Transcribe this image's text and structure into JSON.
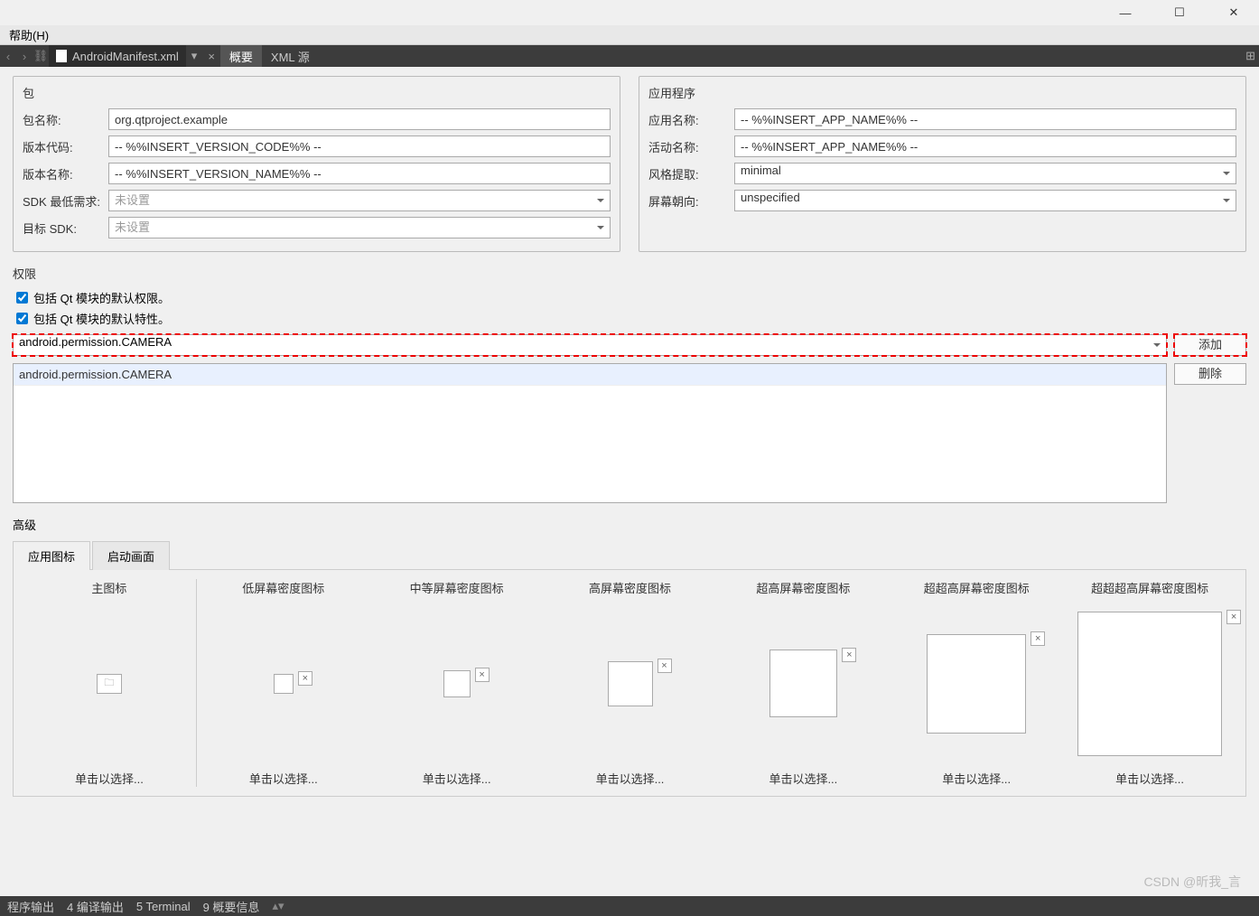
{
  "menu": {
    "help": "帮助(H)"
  },
  "file_tab": {
    "name": "AndroidManifest.xml"
  },
  "sub_tabs": {
    "summary": "概要",
    "xml_source": "XML 源"
  },
  "package_group": {
    "title": "包",
    "name_label": "包名称:",
    "name_value": "org.qtproject.example",
    "version_code_label": "版本代码:",
    "version_code_value": "-- %%INSERT_VERSION_CODE%% --",
    "version_name_label": "版本名称:",
    "version_name_value": "-- %%INSERT_VERSION_NAME%% --",
    "min_sdk_label": "SDK 最低需求:",
    "min_sdk_value": "未设置",
    "target_sdk_label": "目标 SDK:",
    "target_sdk_value": "未设置"
  },
  "app_group": {
    "title": "应用程序",
    "app_name_label": "应用名称:",
    "app_name_value": "-- %%INSERT_APP_NAME%% --",
    "activity_name_label": "活动名称:",
    "activity_name_value": "-- %%INSERT_APP_NAME%% --",
    "style_extract_label": "风格提取:",
    "style_extract_value": "minimal",
    "orientation_label": "屏幕朝向:",
    "orientation_value": "unspecified"
  },
  "permissions": {
    "title": "权限",
    "include_qt_perms": "包括 Qt 模块的默认权限。",
    "include_qt_features": "包括 Qt 模块的默认特性。",
    "combo_value": "android.permission.CAMERA",
    "add_btn": "添加",
    "remove_btn": "删除",
    "list": [
      "android.permission.CAMERA"
    ]
  },
  "advanced": {
    "title": "高级",
    "tab_icon": "应用图标",
    "tab_splash": "启动画面",
    "master_label": "主图标",
    "density_labels": [
      "低屏幕密度图标",
      "中等屏幕密度图标",
      "高屏幕密度图标",
      "超高屏幕密度图标",
      "超超高屏幕密度图标",
      "超超超高屏幕密度图标"
    ],
    "click_select": "单击以选择..."
  },
  "bottom": {
    "compile": "程序输出",
    "build": "4  编译输出",
    "terminal": "5  Terminal",
    "summary": "9  概要信息"
  },
  "watermark": "CSDN @昕我_言"
}
